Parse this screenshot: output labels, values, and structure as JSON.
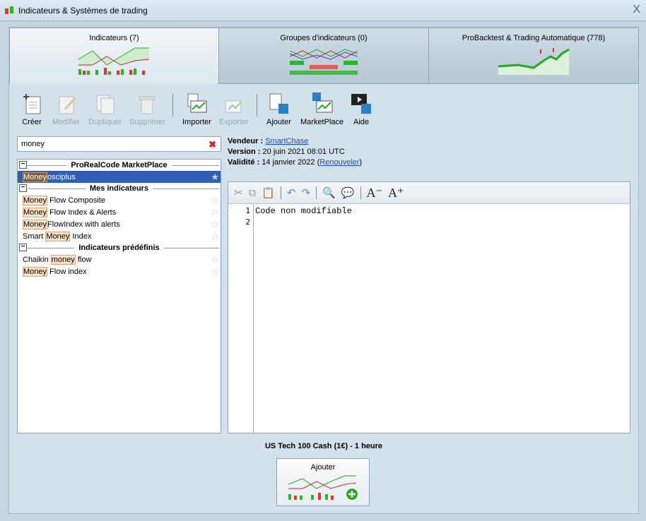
{
  "window": {
    "title": "Indicateurs & Systèmes de trading",
    "close": "X"
  },
  "tabs": [
    {
      "label": "Indicateurs (7)"
    },
    {
      "label": "Groupes d'indicateurs (0)"
    },
    {
      "label": "ProBacktest & Trading Automatique (778)"
    }
  ],
  "toolbar": {
    "create": "Créer",
    "modify": "Modifier",
    "duplicate": "Dupliquer",
    "delete": "Supprimer",
    "import": "Importer",
    "export": "Exporter",
    "add": "Ajouter",
    "marketplace": "MarketPlace",
    "help": "Aide"
  },
  "search": {
    "value": "money"
  },
  "groups": [
    {
      "label": "ProRealCode MarketPlace",
      "items": [
        {
          "pre": "",
          "match": "Money",
          "post": "osciplus",
          "selected": true
        }
      ]
    },
    {
      "label": "Mes indicateurs",
      "items": [
        {
          "pre": "",
          "match": "Money",
          "post": " Flow Composite"
        },
        {
          "pre": "",
          "match": "Money",
          "post": " Flow Index & Alerts"
        },
        {
          "pre": "",
          "match": "Money",
          "post": "FlowIndex with alerts"
        },
        {
          "pre": "Smart ",
          "match": "Money",
          "post": " Index"
        }
      ]
    },
    {
      "label": "Indicateurs prédéfinis",
      "items": [
        {
          "pre": "Chaikin ",
          "match": "money",
          "post": " flow"
        },
        {
          "pre": "",
          "match": "Money",
          "post": " Flow index"
        }
      ]
    }
  ],
  "info": {
    "vendor_label": "Vendeur :",
    "vendor": "SmartChase",
    "version_label": "Version :",
    "version": "20 juin 2021 08:01 UTC",
    "validity_label": "Validité :",
    "validity": "14 janvier 2022",
    "renew_open": "(",
    "renew": "Renouveler",
    "renew_close": ")"
  },
  "editor": {
    "lines": [
      "1",
      "2"
    ],
    "code": "Code non modifiable"
  },
  "footer": {
    "instrument": "US Tech 100 Cash (1€) - 1 heure",
    "add_label": "Ajouter"
  }
}
